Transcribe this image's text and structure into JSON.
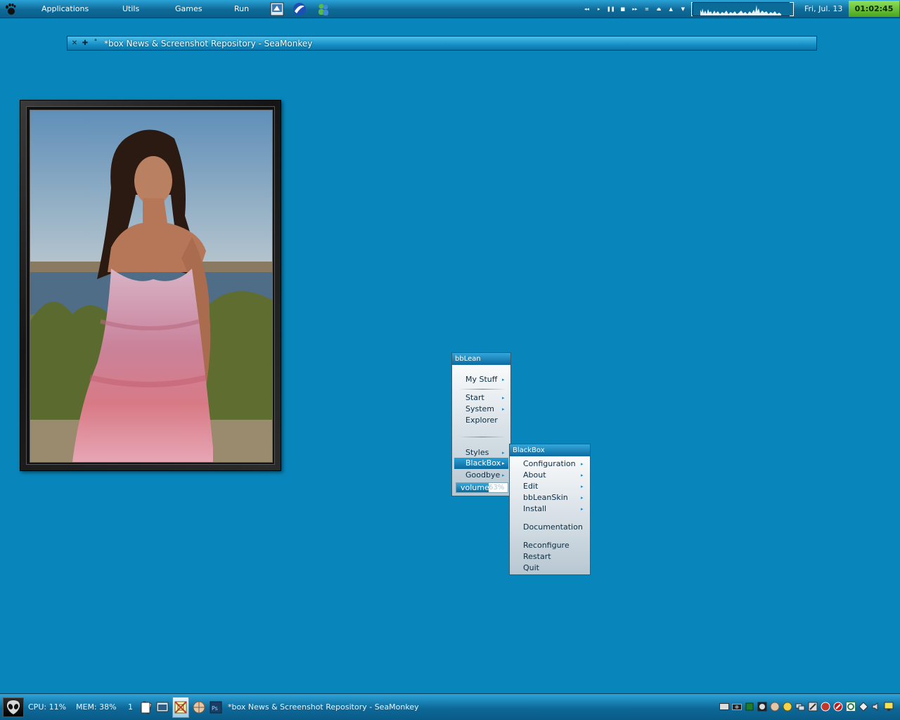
{
  "topbar": {
    "menus": [
      "Applications",
      "Utils",
      "Games",
      "Run"
    ],
    "media_buttons": [
      "prev",
      "play",
      "pause",
      "stop",
      "next",
      "playlist",
      "eject",
      "vol-up",
      "vol-down"
    ],
    "date": "Fri, Jul. 13",
    "clock": "01:02:45"
  },
  "window": {
    "title": "*box News & Screenshot Repository - SeaMonkey",
    "buttons": [
      "close",
      "raise",
      "shade"
    ]
  },
  "main_menu": {
    "title": "bbLean",
    "items": [
      {
        "label": "My Stuff",
        "submenu": true
      },
      {
        "label": "Start",
        "submenu": true
      },
      {
        "label": "System",
        "submenu": true
      },
      {
        "label": "Explorer",
        "submenu": false
      },
      {
        "label": "Styles",
        "submenu": true
      },
      {
        "label": "BlackBox",
        "submenu": true,
        "active": true
      },
      {
        "label": "Goodbye",
        "submenu": true
      }
    ],
    "volume": {
      "label": "volume",
      "percent_text": "63%",
      "level": 0.63
    }
  },
  "blackbox_menu": {
    "title": "BlackBox",
    "items": [
      {
        "label": "Configuration",
        "submenu": true
      },
      {
        "label": "About",
        "submenu": true
      },
      {
        "label": "Edit",
        "submenu": true
      },
      {
        "label": "bbLeanSkin",
        "submenu": true
      },
      {
        "label": "Install",
        "submenu": true
      },
      {
        "label": "Documentation",
        "submenu": false
      },
      {
        "label": "Reconfigure",
        "submenu": false
      },
      {
        "label": "Restart",
        "submenu": false
      },
      {
        "label": "Quit",
        "submenu": false
      }
    ]
  },
  "taskbar": {
    "cpu": "CPU: 11%",
    "mem": "MEM: 38%",
    "workspace": "1",
    "active_task": "*box News & Screenshot Repository - SeaMonkey"
  },
  "colors": {
    "desktop": "#0886bb",
    "clock_bg": "#6ec63a",
    "menu_accent": "#0b6a9e"
  }
}
